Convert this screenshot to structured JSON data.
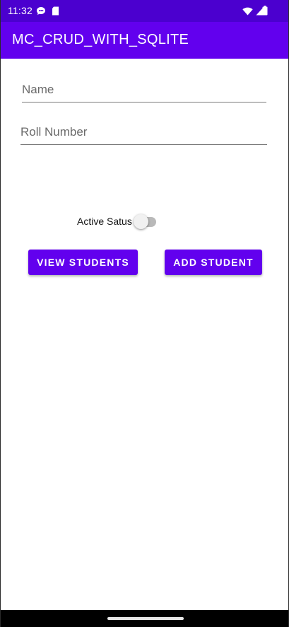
{
  "status_bar": {
    "time": "11:32",
    "icons": [
      "chat-notification-icon",
      "sd-card-icon",
      "wifi-icon",
      "signal-icon",
      "battery-icon"
    ]
  },
  "app_bar": {
    "title": "MC_CRUD_WITH_SQLITE",
    "color": "#6200ee"
  },
  "form": {
    "name": {
      "placeholder": "Name",
      "value": ""
    },
    "roll_number": {
      "placeholder": "Roll Number",
      "value": ""
    },
    "active_switch": {
      "label": "Active Satus",
      "checked": false
    }
  },
  "buttons": {
    "view_students": "VIEW STUDENTS",
    "add_student": "ADD STUDENT"
  },
  "colors": {
    "status_bar": "#4b00cf",
    "primary": "#6200ee",
    "background": "#ffffff"
  }
}
